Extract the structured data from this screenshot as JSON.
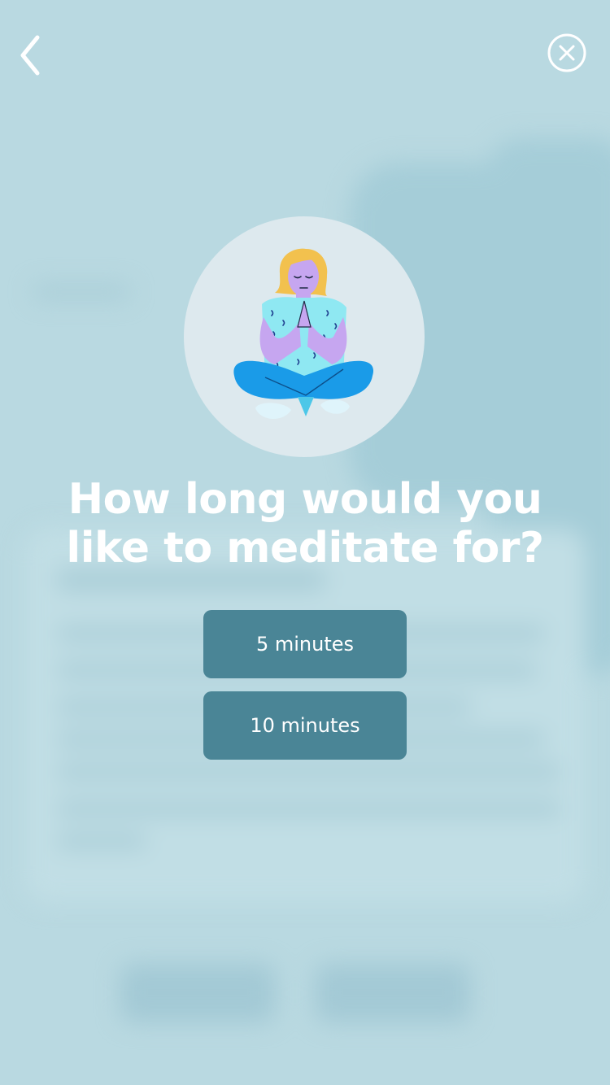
{
  "nav": {
    "back_icon": "chevron-left-icon",
    "close_icon": "close-circle-icon"
  },
  "illustration": {
    "icon": "meditating-person-illustration"
  },
  "prompt": {
    "title": "How long would you like to meditate for?"
  },
  "options": [
    {
      "label": "5 minutes"
    },
    {
      "label": "10 minutes"
    }
  ],
  "colors": {
    "background": "#b9d9e1",
    "button": "#4a8596",
    "text": "#ffffff",
    "illustration_circle": "#dde9ee"
  }
}
